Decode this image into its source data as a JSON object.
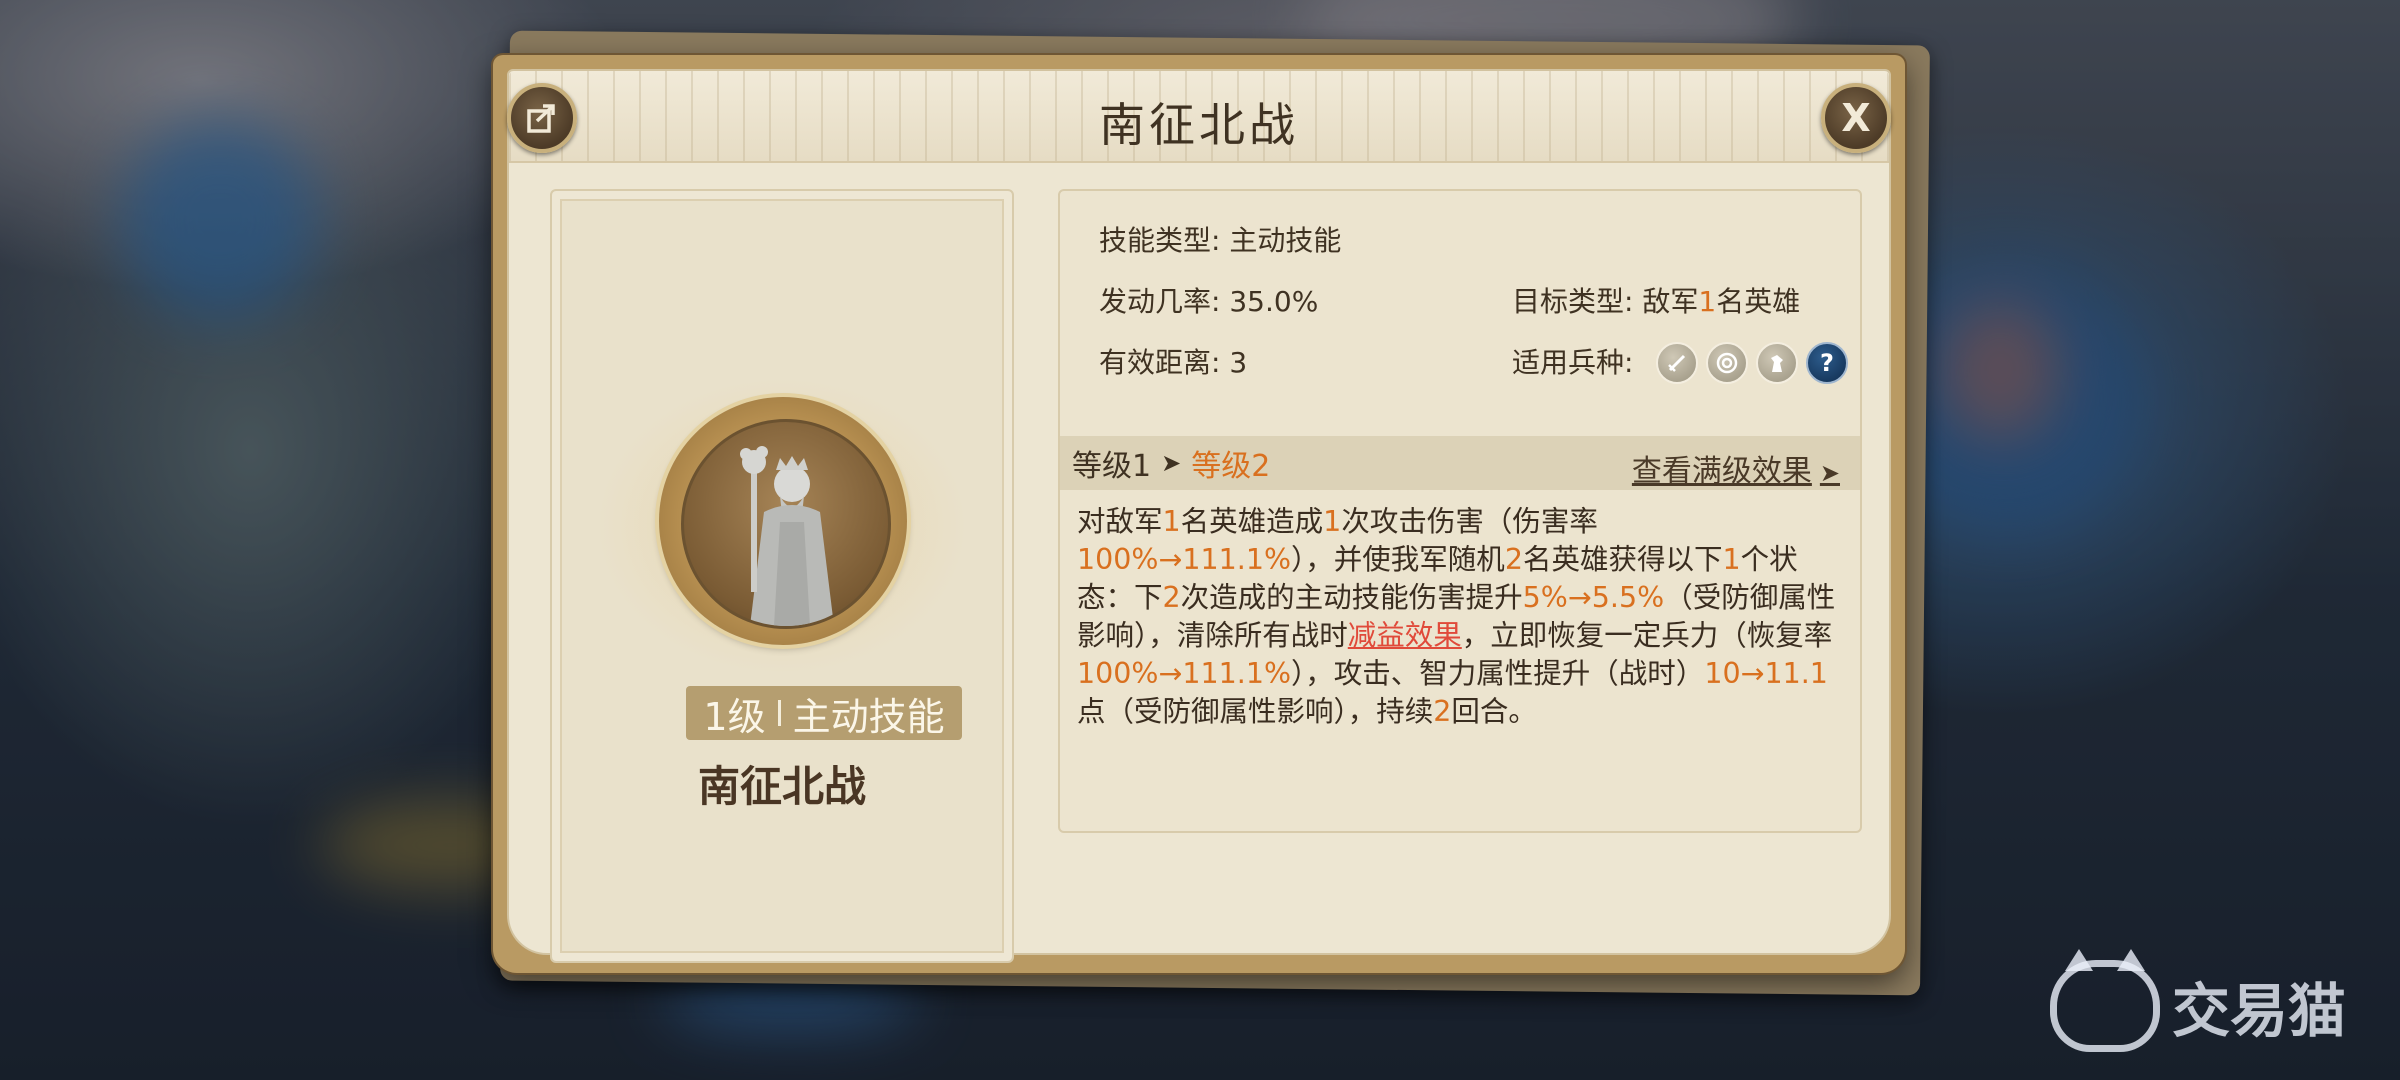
{
  "dialog": {
    "title": "南征北战",
    "close_label": "X"
  },
  "left_panel": {
    "level_label": "1级",
    "skill_kind": "主动技能",
    "skill_name": "南征北战"
  },
  "info": {
    "skill_type_label": "技能类型:",
    "skill_type_value": "主动技能",
    "trigger_rate_label": "发动几率:",
    "trigger_rate_value": "35.0%",
    "target_type_label": "目标类型:",
    "target_type_pre": "敌军",
    "target_type_num": "1",
    "target_type_post": "名英雄",
    "range_label": "有效距离:",
    "range_value": "3",
    "troop_label": "适用兵种:",
    "troop_icons": [
      "infantry-sword-icon",
      "archer-target-icon",
      "cavalry-horse-icon",
      "unknown-question-icon"
    ],
    "question_mark": "?"
  },
  "level_bar": {
    "from": "等级1",
    "arrow": "➤",
    "to": "等级2",
    "view_full": "查看满级效果",
    "view_arrow": "➤"
  },
  "description": {
    "p1": "对敌军",
    "n1": "1",
    "p2": "名英雄造成",
    "n2": "1",
    "p3": "次攻击伤害（伤害率",
    "n3": "100%",
    "n4": "→111.1%",
    "p4": "），并使我军随机",
    "n5": "2",
    "p5": "名英雄获得以下",
    "n6": "1",
    "p6": "个状态：下",
    "n7": "2",
    "p7": "次造成的主动技能伤害提升",
    "n8": "5%",
    "n9": "→5.5%",
    "p8": "（受防御属性影响），清除所有战时",
    "red": "减益效果",
    "p9": "，立即恢复一定兵力（恢复率",
    "n10": "100%",
    "n11": "→111.1%",
    "p10": "），攻击、智力属性提升（战时）",
    "n12": "10",
    "n13": "→11.1",
    "p11": "点（受防御属性影响），持续",
    "n14": "2",
    "p12": "回合。"
  },
  "watermark": {
    "text": "交易猫"
  }
}
